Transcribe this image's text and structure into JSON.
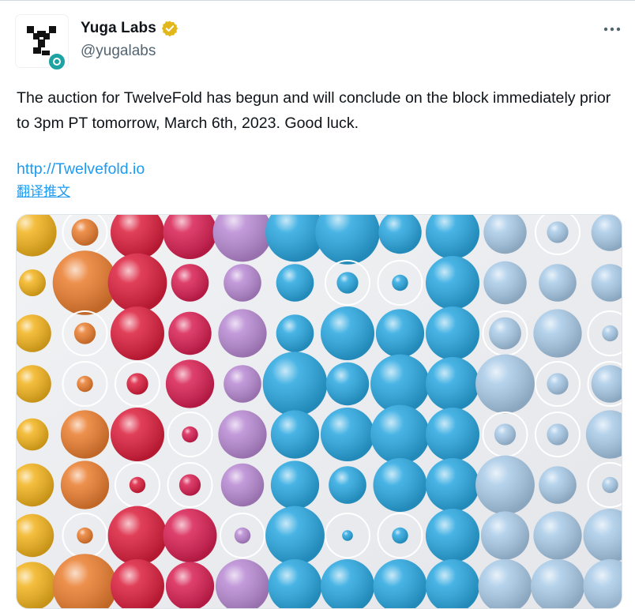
{
  "tweet": {
    "author": {
      "display_name": "Yuga Labs",
      "handle": "@yugalabs",
      "verified_icon": "verified-gold-badge-icon",
      "avatar_icon": "yuga-labs-logo"
    },
    "more_icon": "more-options-icon",
    "text": "The auction for TwelveFold has begun and will conclude on the block immediately prior to 3pm PT tomorrow, March 6th, 2023. Good luck.",
    "link": "http://Twelvefold.io",
    "translate_label": "翻译推文",
    "media": {
      "description_icon": "twelvefold-spheres-artwork",
      "palette": {
        "yellow": "#f2b31d",
        "orange": "#ea7d2f",
        "red": "#dc1e3c",
        "magenta": "#d81f52",
        "purple": "#b889d3",
        "blue": "#29a7e0",
        "light_blue": "#a9cbe8"
      }
    }
  }
}
